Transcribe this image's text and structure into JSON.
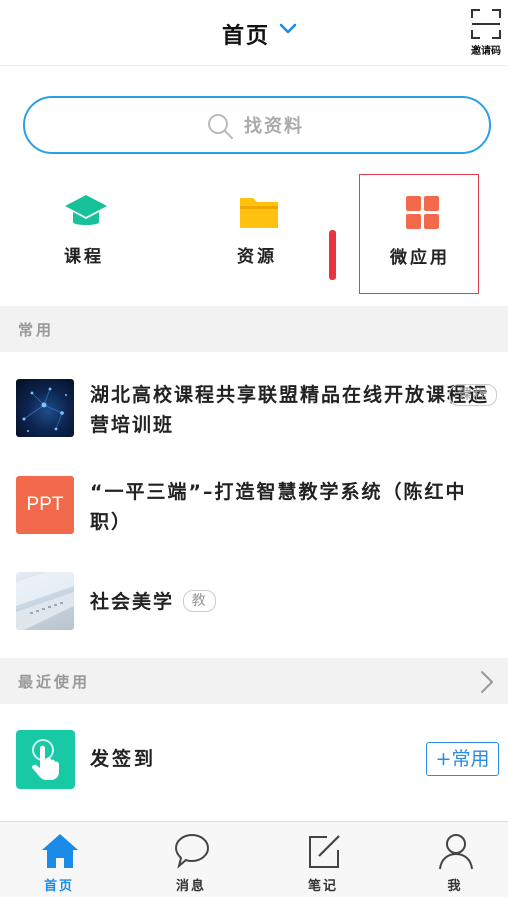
{
  "header": {
    "title": "首页",
    "invite_label": "邀请码"
  },
  "search": {
    "placeholder": "找资料"
  },
  "quick_entries": [
    {
      "label": "课程",
      "icon": "graduation-cap-icon",
      "color": "#17c29a"
    },
    {
      "label": "资源",
      "icon": "folder-icon",
      "color": "#ffc20e"
    },
    {
      "label": "微应用",
      "icon": "app-grid-icon",
      "color": "#f26a4b"
    }
  ],
  "sections": {
    "common": "常用",
    "recent": "最近使用"
  },
  "common_items": [
    {
      "title": "湖北高校课程共享联盟精品在线开放课程运营培训班",
      "tag": "课程"
    },
    {
      "title": "“一平三端”–打造智慧教学系统（陈红中职）",
      "thumb_text": "PPT"
    },
    {
      "title": "社会美学",
      "tag": "教"
    }
  ],
  "recent_items": [
    {
      "title": "发签到",
      "action": "+常用",
      "icon": "hand-tap-icon"
    }
  ],
  "tabbar": [
    {
      "label": "首页",
      "icon": "home-icon",
      "active": true
    },
    {
      "label": "消息",
      "icon": "chat-bubble-icon",
      "active": false
    },
    {
      "label": "笔记",
      "icon": "note-edit-icon",
      "active": false
    },
    {
      "label": "我",
      "icon": "user-icon",
      "active": false
    }
  ],
  "colors": {
    "accent_blue": "#2aa0e6",
    "active_tab": "#1a8be6",
    "highlight_border": "#e0404a"
  }
}
